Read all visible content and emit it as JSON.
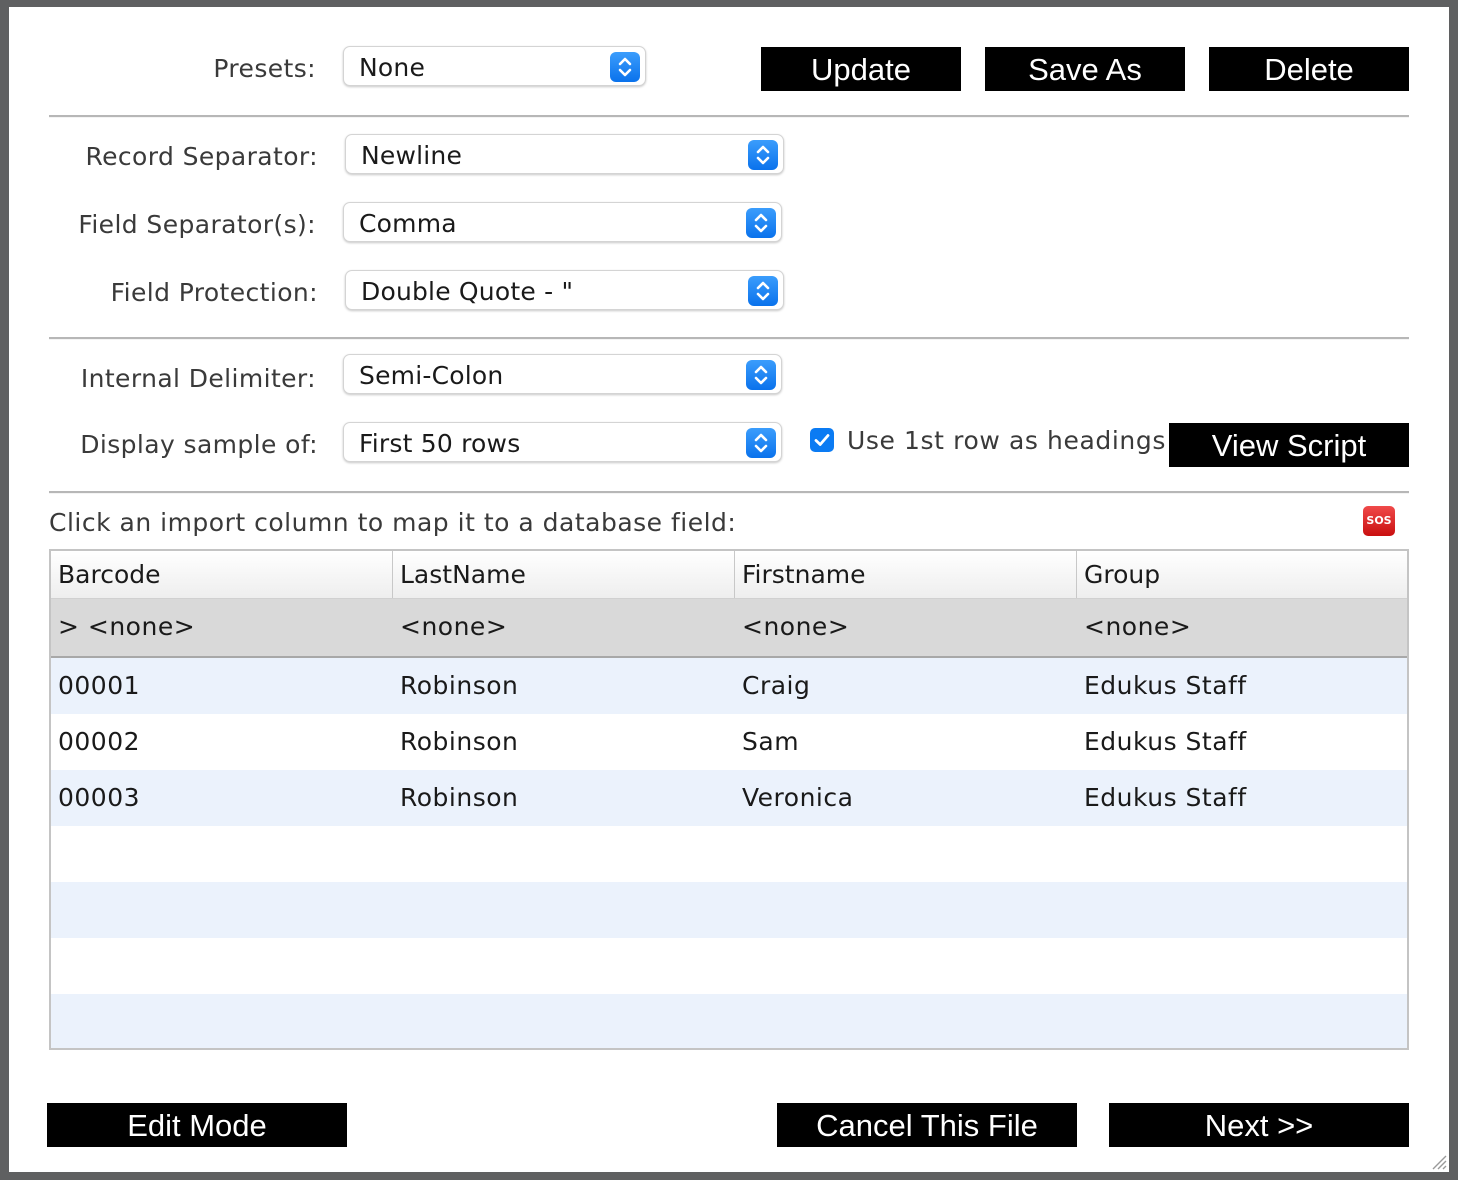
{
  "presets": {
    "label": "Presets:",
    "value": "None"
  },
  "preset_buttons": {
    "update": "Update",
    "save_as": "Save As",
    "delete": "Delete"
  },
  "record_separator": {
    "label": "Record Separator:",
    "value": "Newline"
  },
  "field_separator": {
    "label": "Field Separator(s):",
    "value": "Comma"
  },
  "field_protection": {
    "label": "Field Protection:",
    "value": "Double Quote - \""
  },
  "internal_delimiter": {
    "label": "Internal Delimiter:",
    "value": "Semi-Colon"
  },
  "display_sample": {
    "label": "Display sample of:",
    "value": "First 50 rows"
  },
  "use_headings": {
    "label": "Use 1st row as headings",
    "checked": true
  },
  "view_script": "View Script",
  "hint": "Click an import column to map it to a database field:",
  "sos_icon": {
    "text": "SOS",
    "color": "#e02020"
  },
  "table": {
    "columns": [
      "Barcode",
      "LastName",
      "Firstname",
      "Group"
    ],
    "mapping": [
      "> <none>",
      "<none>",
      "<none>",
      "<none>"
    ],
    "rows": [
      [
        "00001",
        "Robinson",
        "Craig",
        "Edukus Staff"
      ],
      [
        "00002",
        "Robinson",
        "Sam",
        "Edukus Staff"
      ],
      [
        "00003",
        "Robinson",
        "Veronica",
        "Edukus Staff"
      ]
    ]
  },
  "footer": {
    "edit_mode": "Edit Mode",
    "cancel": "Cancel This File",
    "next": "Next >>"
  },
  "colors": {
    "accent": "#0b7bf3",
    "button_bg": "#000000",
    "row_alt": "#ebf2fc"
  }
}
